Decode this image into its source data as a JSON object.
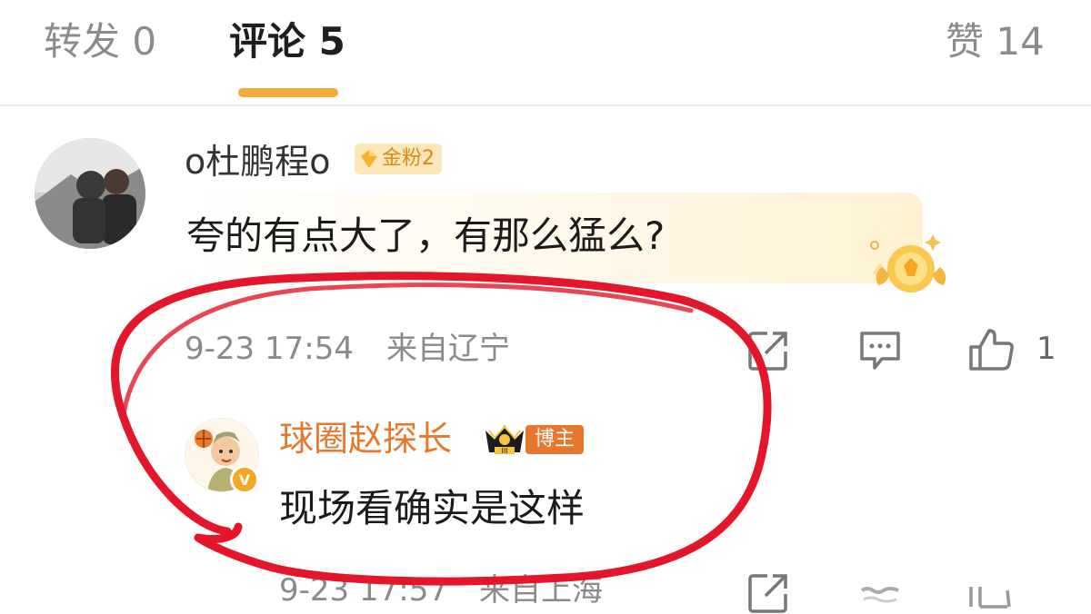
{
  "tabs": [
    {
      "label": "转发 0"
    },
    {
      "label": "评论 5"
    },
    {
      "label": "赞 14"
    }
  ],
  "comment": {
    "username": "o杜鹏程o",
    "badge": "金粉2",
    "text": "夸的有点大了，有那么猛么?",
    "time": "9-23 17:54",
    "location": "来自辽宁",
    "like_count": "1"
  },
  "reply": {
    "username": "球圈赵探长",
    "badge": "博主",
    "crown_level": "III",
    "text": "现场看确实是这样",
    "time": "9-23 17:57",
    "location": "来自上海"
  },
  "colors": {
    "accent": "#f4a93b",
    "blogger": "#e8772e",
    "annotation": "#e3162a"
  },
  "icons": [
    "share-icon",
    "comment-icon",
    "like-icon",
    "crown-icon",
    "verified-icon"
  ]
}
